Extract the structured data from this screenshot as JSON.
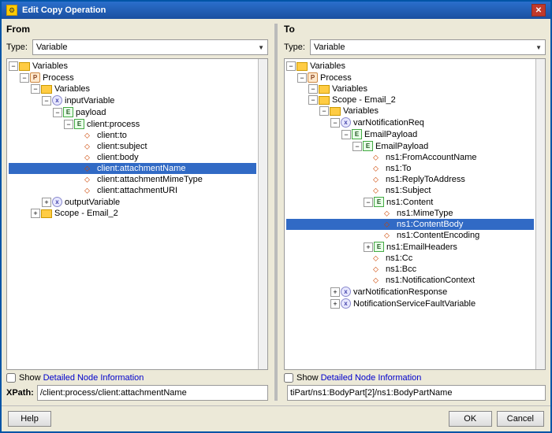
{
  "window": {
    "title": "Edit Copy Operation",
    "close_label": "✕"
  },
  "from_panel": {
    "title": "From",
    "type_label": "Type:",
    "type_value": "Variable",
    "checkbox_label": "Show Detailed Node Information",
    "xpath_label": "XPath:",
    "xpath_value": "/client:process/client:attachmentName"
  },
  "to_panel": {
    "title": "To",
    "type_label": "Type:",
    "type_value": "Variable",
    "checkbox_label": "Show Detailed Node Information",
    "xpath_value": "tiPart/ns1:BodyPart[2]/ns1:BodyPartName"
  },
  "footer": {
    "help_label": "Help",
    "ok_label": "OK",
    "cancel_label": "Cancel"
  },
  "from_tree": [
    {
      "id": "vars",
      "label": "Variables",
      "indent": 0,
      "type": "folder",
      "toggle": "expanded"
    },
    {
      "id": "process",
      "label": "Process",
      "indent": 1,
      "type": "process",
      "toggle": "expanded"
    },
    {
      "id": "variables2",
      "label": "Variables",
      "indent": 2,
      "type": "folder",
      "toggle": "expanded"
    },
    {
      "id": "inputVariable",
      "label": "inputVariable",
      "indent": 3,
      "type": "var",
      "toggle": "expanded"
    },
    {
      "id": "payload",
      "label": "payload",
      "indent": 4,
      "type": "elem",
      "toggle": "expanded"
    },
    {
      "id": "client_process",
      "label": "client:process",
      "indent": 5,
      "type": "elem",
      "toggle": "expanded"
    },
    {
      "id": "client_to",
      "label": "client:to",
      "indent": 6,
      "type": "attr"
    },
    {
      "id": "client_subject",
      "label": "client:subject",
      "indent": 6,
      "type": "attr"
    },
    {
      "id": "client_body",
      "label": "client:body",
      "indent": 6,
      "type": "attr"
    },
    {
      "id": "client_attachmentName",
      "label": "client:attachmentName",
      "indent": 6,
      "type": "attr",
      "selected": true
    },
    {
      "id": "client_attachmentMimeType",
      "label": "client:attachmentMimeType",
      "indent": 6,
      "type": "attr"
    },
    {
      "id": "client_attachmentURI",
      "label": "client:attachmentURI",
      "indent": 6,
      "type": "attr"
    },
    {
      "id": "outputVariable",
      "label": "outputVariable",
      "indent": 3,
      "type": "var",
      "toggle": "collapsed"
    },
    {
      "id": "scope_email2",
      "label": "Scope - Email_2",
      "indent": 2,
      "type": "folder",
      "toggle": "collapsed"
    }
  ],
  "to_tree": [
    {
      "id": "vars",
      "label": "Variables",
      "indent": 0,
      "type": "folder",
      "toggle": "expanded"
    },
    {
      "id": "process",
      "label": "Process",
      "indent": 1,
      "type": "process",
      "toggle": "expanded"
    },
    {
      "id": "variables2",
      "label": "Variables",
      "indent": 2,
      "type": "folder",
      "toggle": "expanded"
    },
    {
      "id": "scope_email2",
      "label": "Scope - Email_2",
      "indent": 2,
      "type": "folder",
      "toggle": "expanded"
    },
    {
      "id": "variables3",
      "label": "Variables",
      "indent": 3,
      "type": "folder",
      "toggle": "expanded"
    },
    {
      "id": "varNotificationReq",
      "label": "varNotificationReq",
      "indent": 4,
      "type": "var",
      "toggle": "expanded"
    },
    {
      "id": "EmailPayload",
      "label": "EmailPayload",
      "indent": 5,
      "type": "elem",
      "toggle": "expanded"
    },
    {
      "id": "EmailPayload2",
      "label": "EmailPayload",
      "indent": 6,
      "type": "elem",
      "toggle": "expanded"
    },
    {
      "id": "ns1_FromAccountName",
      "label": "ns1:FromAccountName",
      "indent": 7,
      "type": "attr"
    },
    {
      "id": "ns1_To",
      "label": "ns1:To",
      "indent": 7,
      "type": "attr"
    },
    {
      "id": "ns1_ReplyToAddress",
      "label": "ns1:ReplyToAddress",
      "indent": 7,
      "type": "attr"
    },
    {
      "id": "ns1_Subject",
      "label": "ns1:Subject",
      "indent": 7,
      "type": "attr"
    },
    {
      "id": "ns1_Content",
      "label": "ns1:Content",
      "indent": 7,
      "type": "elem",
      "toggle": "expanded"
    },
    {
      "id": "ns1_MimeType",
      "label": "ns1:MimeType",
      "indent": 8,
      "type": "attr"
    },
    {
      "id": "ns1_ContentBody",
      "label": "ns1:ContentBody",
      "indent": 8,
      "type": "attr",
      "selected": true
    },
    {
      "id": "ns1_ContentEncoding",
      "label": "ns1:ContentEncoding",
      "indent": 8,
      "type": "attr"
    },
    {
      "id": "ns1_EmailHeaders",
      "label": "ns1:EmailHeaders",
      "indent": 7,
      "type": "elem",
      "toggle": "collapsed"
    },
    {
      "id": "ns1_Cc",
      "label": "ns1:Cc",
      "indent": 7,
      "type": "attr"
    },
    {
      "id": "ns1_Bcc",
      "label": "ns1:Bcc",
      "indent": 7,
      "type": "attr"
    },
    {
      "id": "ns1_NotificationContext",
      "label": "ns1:NotificationContext",
      "indent": 7,
      "type": "attr"
    },
    {
      "id": "varNotificationResponse",
      "label": "varNotificationResponse",
      "indent": 4,
      "type": "var",
      "toggle": "collapsed"
    },
    {
      "id": "NotificationServiceFaultVariable",
      "label": "NotificationServiceFaultVariable",
      "indent": 4,
      "type": "var",
      "toggle": "collapsed"
    }
  ]
}
